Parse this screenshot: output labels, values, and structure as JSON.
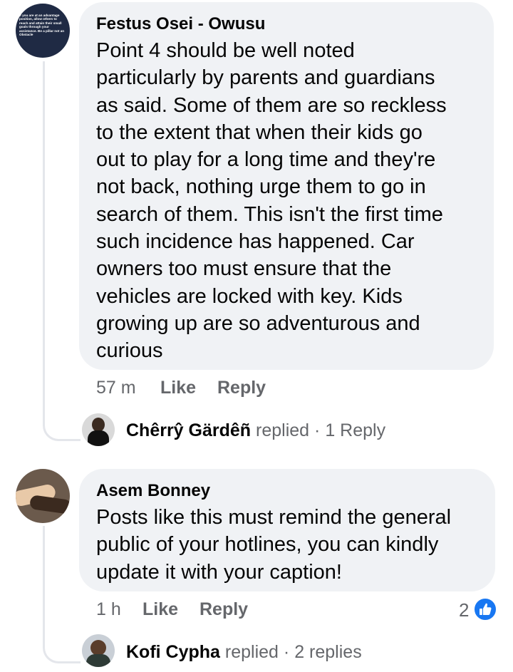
{
  "comments": [
    {
      "author": "Festus Osei - Owusu",
      "avatar_text": "If you are at an advantage position, allow others to reach and attain their small goals through your assistance. Be a pillar not an Obstacle",
      "lines": [
        "Point 4 should be well noted",
        "particularly by parents and guardians",
        "as said. Some of them are so reckless",
        "to the extent that when their kids go",
        "out to play for a long time and they're",
        "not back, nothing urge them to go in",
        "search of them. This isn't the first time",
        "such incidence has happened. Car",
        "owners too must ensure that the",
        "vehicles are locked with key. Kids",
        "growing up are so adventurous and",
        "curious"
      ],
      "time": "57 m",
      "like_label": "Like",
      "reply_label": "Reply",
      "reply_preview": {
        "name": "Chêrrŷ Gärdêñ",
        "verb": "replied",
        "separator": "·",
        "count": "1 Reply"
      }
    },
    {
      "author": "Asem Bonney",
      "lines": [
        "Posts like this must remind the general",
        "public of your hotlines, you can kindly",
        "update it with your caption!"
      ],
      "time": "1 h",
      "like_label": "Like",
      "reply_label": "Reply",
      "reaction_count": "2",
      "reaction_icon": "thumbs-up-icon",
      "reply_preview": {
        "name": "Kofi Cypha",
        "verb": "replied",
        "separator": "·",
        "count": "2 replies"
      }
    }
  ],
  "colors": {
    "bubble": "#f0f2f5",
    "meta_text": "#65676b",
    "like_blue": "#1877f2",
    "thread_line": "#e4e6eb"
  }
}
